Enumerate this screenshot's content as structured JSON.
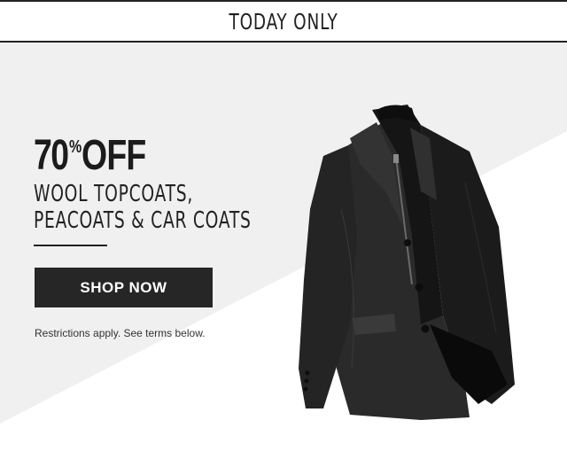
{
  "banner": {
    "text": "TODAY ONLY"
  },
  "offer": {
    "percent": "70",
    "percent_sign": "%",
    "off": "OFF",
    "subhead_line1": "WOOL TOPCOATS,",
    "subhead_line2": "PEACOATS & CAR COATS"
  },
  "cta": {
    "label": "SHOP NOW"
  },
  "restrictions": {
    "text": "Restrictions apply. See terms below."
  },
  "colors": {
    "background_light": "#f0f0f0",
    "button": "#262626",
    "text": "#1c1c1c"
  }
}
